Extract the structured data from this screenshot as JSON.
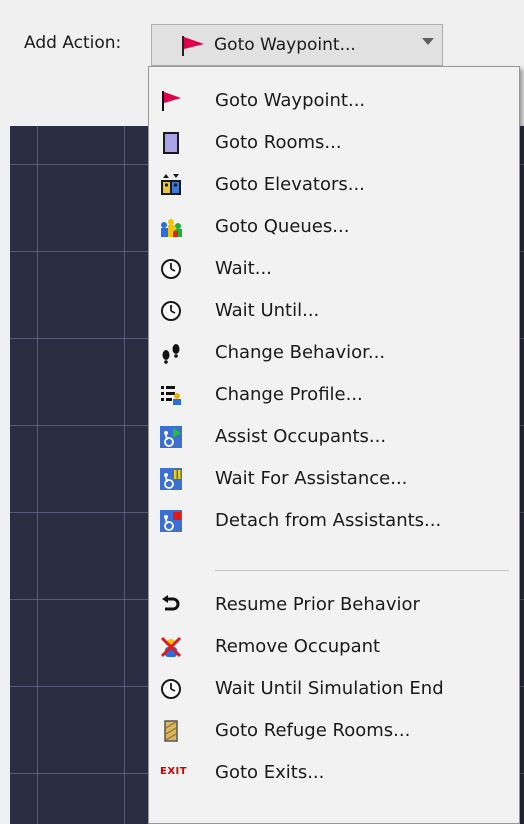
{
  "toolbar": {
    "add_action_label": "Add Action:",
    "selected_value": "Goto Waypoint...",
    "selected_icon": "flag-icon"
  },
  "menu": {
    "items": [
      {
        "label": "Goto Waypoint...",
        "icon": "flag-icon"
      },
      {
        "label": "Goto Rooms...",
        "icon": "room-icon"
      },
      {
        "label": "Goto Elevators...",
        "icon": "elevator-icon"
      },
      {
        "label": "Goto Queues...",
        "icon": "queues-icon"
      },
      {
        "label": "Wait...",
        "icon": "clock-icon"
      },
      {
        "label": "Wait Until...",
        "icon": "clock-icon"
      },
      {
        "label": "Change Behavior...",
        "icon": "footprints-icon"
      },
      {
        "label": "Change Profile...",
        "icon": "profile-icon"
      },
      {
        "label": "Assist Occupants...",
        "icon": "assist-play-icon"
      },
      {
        "label": "Wait For Assistance...",
        "icon": "assist-pause-icon"
      },
      {
        "label": "Detach from Assistants...",
        "icon": "assist-stop-icon"
      },
      {
        "label": "Resume Prior Behavior",
        "icon": "undo-arrow-icon"
      },
      {
        "label": "Remove Occupant",
        "icon": "remove-occupant-icon"
      },
      {
        "label": "Wait Until Simulation End",
        "icon": "clock-icon"
      },
      {
        "label": "Goto Refuge Rooms...",
        "icon": "refuge-room-icon"
      },
      {
        "label": "Goto Exits...",
        "icon": "exit-icon",
        "icon_text": "EXIT"
      }
    ]
  },
  "colors": {
    "flag": "#e0004a",
    "canvas": "#2b2e42",
    "accessibility_blue": "#3b6fd1",
    "exit_red": "#d40000"
  }
}
